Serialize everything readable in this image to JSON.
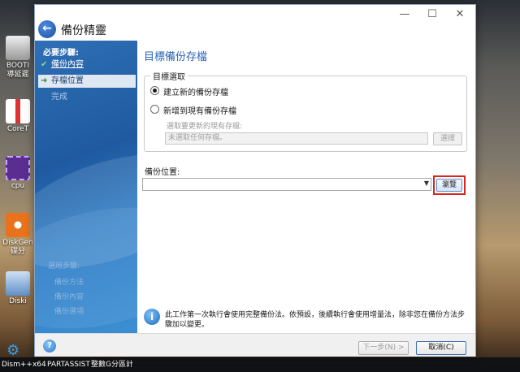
{
  "desktop": {
    "icons": [
      {
        "label": "BOOTI",
        "label2": "導延遲",
        "icon": "boot-app-icon"
      },
      {
        "label": "CoreT",
        "label2": "",
        "icon": "thermometer-icon"
      },
      {
        "label": "cpu",
        "label2": "",
        "icon": "cpu-chip-icon"
      },
      {
        "label": "DiskGen",
        "label2": "碟分",
        "icon": "diskgenius-icon"
      },
      {
        "label": "Diski",
        "label2": "",
        "icon": "disk-tool-icon"
      }
    ],
    "taskbar": {
      "item1": "Dism++x64",
      "item2": "PARTASSIST",
      "item3": "整數G分區計"
    }
  },
  "window": {
    "title": "備份精靈",
    "controls": {
      "minimize": "—",
      "maximize": "☐",
      "close": "✕"
    }
  },
  "sidebar": {
    "heading": "必要步驟:",
    "steps": [
      {
        "label": "備份內容",
        "state": "done",
        "marker": "✔"
      },
      {
        "label": "存檔位置",
        "state": "current",
        "marker": "➜"
      },
      {
        "label": "完成",
        "state": "pending",
        "marker": ""
      }
    ],
    "optional_heading": "選用步驟:",
    "optional_steps": [
      "備份方法",
      "備份內容",
      "備份選項"
    ]
  },
  "main": {
    "title": "目標備份存檔",
    "target_group": {
      "legend": "目標選取",
      "option_new": "建立新的備份存檔",
      "option_existing": "新增到現有備份存檔",
      "selected": "new",
      "existing_hint": "選取要更新的現有存檔:",
      "existing_placeholder": "未選取任何存檔。",
      "existing_browse": "選擇"
    },
    "location": {
      "label": "備份位置:",
      "value": "",
      "browse": "瀏覽"
    },
    "info": "此工作第一次執行會使用完整備份法。依預設，後續執行會使用增量法，除非您在備份方法步驟加以變更。"
  },
  "footer": {
    "next": "下一步(N) >",
    "cancel": "取消(C)"
  }
}
